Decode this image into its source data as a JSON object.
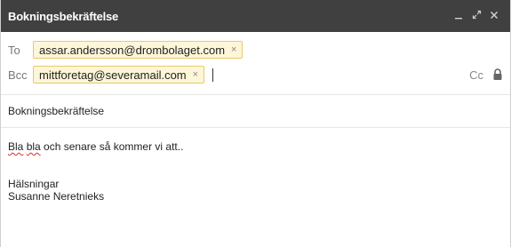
{
  "window": {
    "title": "Bokningsbekräftelse",
    "minimize_icon": "minimize-icon",
    "expand_icon": "expand-icon",
    "close_icon": "close-icon"
  },
  "recipients": {
    "to_label": "To",
    "to_chips": [
      "assar.andersson@drombolaget.com"
    ],
    "bcc_label": "Bcc",
    "bcc_chips": [
      "mittforetag@severamail.com"
    ],
    "cc_label": "Cc",
    "lock_icon": "lock-icon",
    "chip_remove": "×"
  },
  "subject": "Bokningsbekräftelse",
  "body": {
    "line1_misspelled_1": "Bla",
    "line1_misspelled_2": "bla",
    "line1_rest": " och senare så kommer vi att..",
    "greeting": "Hälsningar",
    "signature": "Susanne Neretnieks"
  },
  "colors": {
    "titlebar": "#404040",
    "chip_border": "#e8c96b",
    "chip_bg": "#fdf6d8"
  }
}
